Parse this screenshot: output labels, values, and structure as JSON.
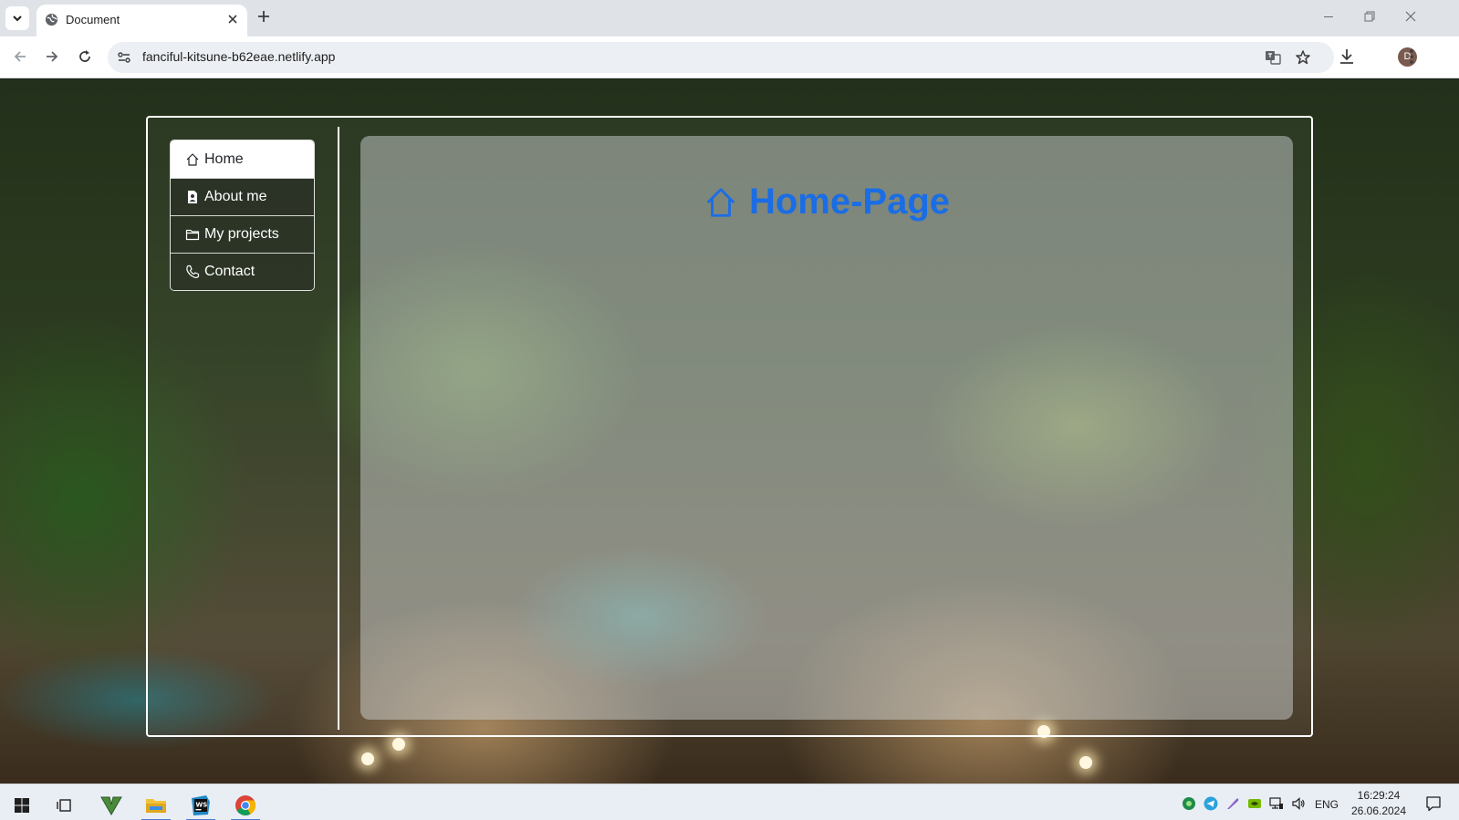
{
  "browser": {
    "tab_title": "Document",
    "url": "fanciful-kitsune-b62eae.netlify.app",
    "profile_initial": "D"
  },
  "nav": {
    "items": [
      {
        "label": "Home",
        "icon": "house-icon",
        "active": true
      },
      {
        "label": "About me",
        "icon": "file-person-icon",
        "active": false
      },
      {
        "label": "My projects",
        "icon": "folder-icon",
        "active": false
      },
      {
        "label": "Contact",
        "icon": "telephone-icon",
        "active": false
      }
    ]
  },
  "main": {
    "heading": "Home-Page",
    "heading_icon": "house-icon",
    "heading_color": "#1a6de5"
  },
  "taskbar": {
    "language": "ENG",
    "time": "16:29:24",
    "date": "26.06.2024"
  }
}
